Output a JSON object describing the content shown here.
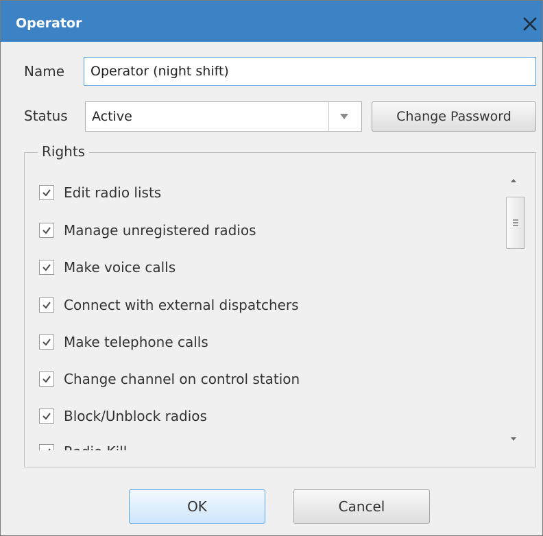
{
  "window": {
    "title": "Operator",
    "close_icon": "close-icon",
    "titlebar_color": "#3c83c6"
  },
  "form": {
    "name_label": "Name",
    "name_value": "Operator (night shift)",
    "status_label": "Status",
    "status_value": "Active",
    "change_password_label": "Change Password"
  },
  "rights": {
    "legend": "Rights",
    "items": [
      {
        "label": "Edit radio lists",
        "checked": true
      },
      {
        "label": "Manage unregistered radios",
        "checked": true
      },
      {
        "label": "Make voice calls",
        "checked": true
      },
      {
        "label": "Connect with external dispatchers",
        "checked": true
      },
      {
        "label": "Make telephone calls",
        "checked": true
      },
      {
        "label": "Change channel on control station",
        "checked": true
      },
      {
        "label": "Block/Unblock radios",
        "checked": true
      },
      {
        "label": "Radio Kill",
        "checked": true
      }
    ]
  },
  "buttons": {
    "ok_label": "OK",
    "cancel_label": "Cancel",
    "ok_accent": "#5aa8e8"
  }
}
